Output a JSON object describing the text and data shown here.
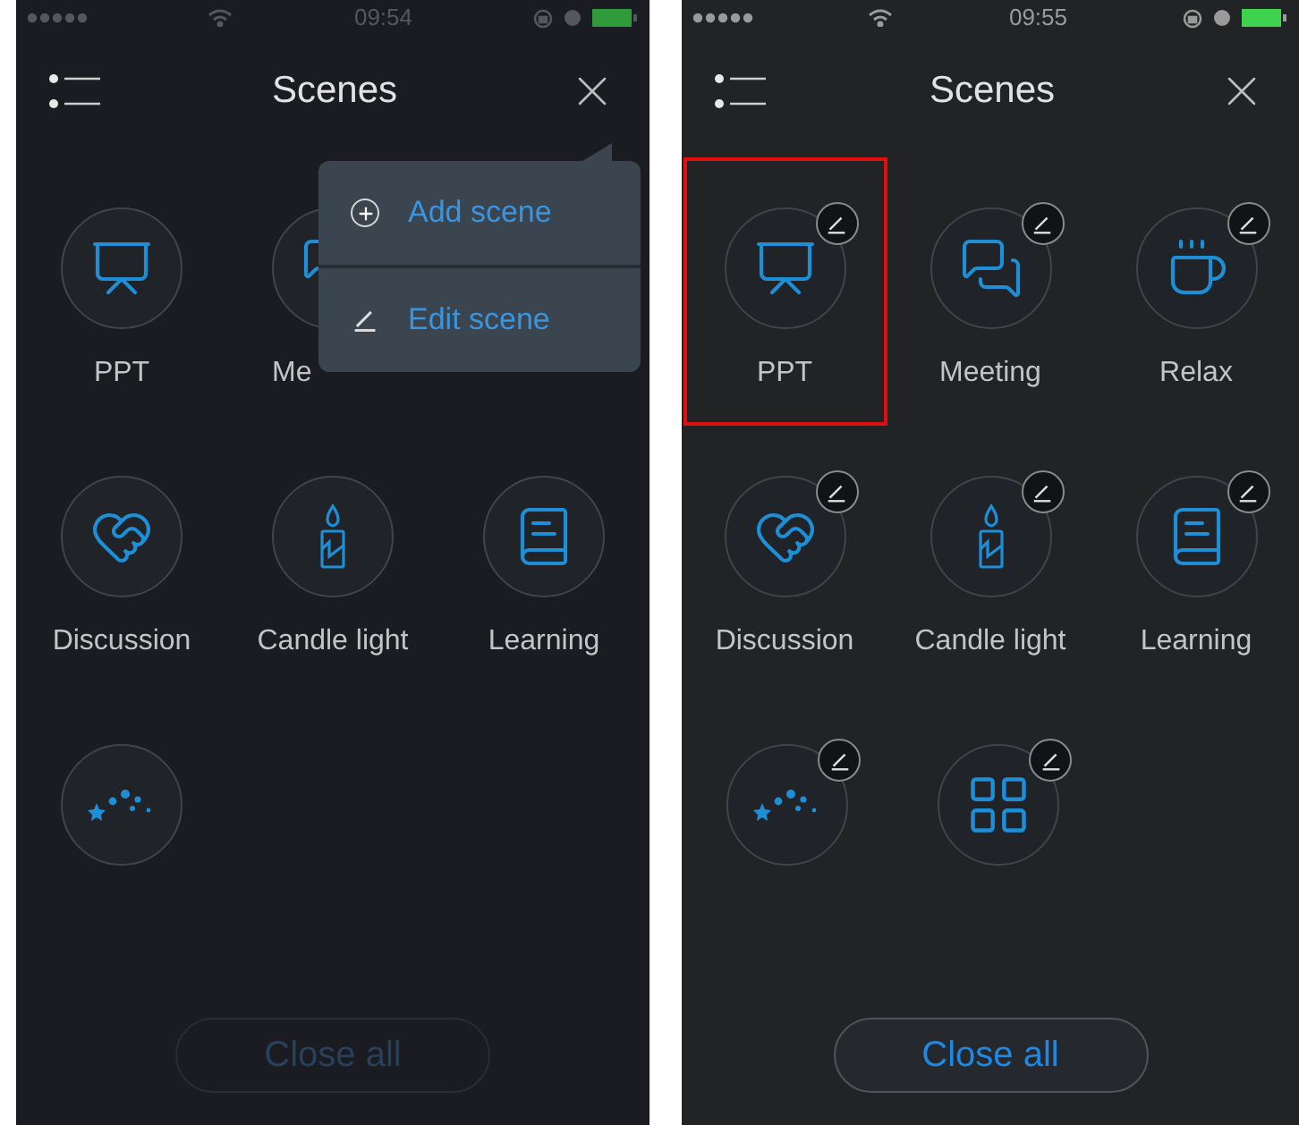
{
  "screens": [
    {
      "status_bar": {
        "time": "09:54"
      },
      "title": "Scenes",
      "popup_menu": [
        {
          "kind": "add",
          "label": "Add scene"
        },
        {
          "kind": "edit",
          "label": "Edit scene"
        }
      ],
      "scene_rows": [
        [
          {
            "kind": "presentation",
            "label": "PPT",
            "editable": false,
            "highlighted": false
          },
          {
            "kind": "chat",
            "label": "Me",
            "cut_off": true,
            "editable": false,
            "highlighted": false
          }
        ],
        [
          {
            "kind": "handshake",
            "label": "Discussion",
            "editable": false,
            "highlighted": false
          },
          {
            "kind": "candle",
            "label": "Candle light",
            "editable": false,
            "highlighted": false
          },
          {
            "kind": "book",
            "label": "Learning",
            "editable": false,
            "highlighted": false
          }
        ],
        [
          {
            "kind": "stars",
            "editable": false,
            "highlighted": false
          }
        ]
      ],
      "close_all": {
        "label": "Close all",
        "disabled": true
      }
    },
    {
      "status_bar": {
        "time": "09:55"
      },
      "title": "Scenes",
      "scene_rows": [
        [
          {
            "kind": "presentation",
            "label": "PPT",
            "editable": true,
            "highlighted": true
          },
          {
            "kind": "chat",
            "label": "Meeting",
            "editable": true,
            "highlighted": false
          },
          {
            "kind": "cup",
            "label": "Relax",
            "editable": true,
            "highlighted": false
          }
        ],
        [
          {
            "kind": "handshake",
            "label": "Discussion",
            "editable": true,
            "highlighted": false
          },
          {
            "kind": "candle",
            "label": "Candle light",
            "editable": true,
            "highlighted": false
          },
          {
            "kind": "book",
            "label": "Learning",
            "editable": true,
            "highlighted": false
          }
        ],
        [
          {
            "kind": "stars",
            "editable": true,
            "highlighted": false
          },
          {
            "kind": "grid",
            "editable": true,
            "highlighted": false
          }
        ]
      ],
      "close_all": {
        "label": "Close all",
        "disabled": false
      }
    }
  ]
}
